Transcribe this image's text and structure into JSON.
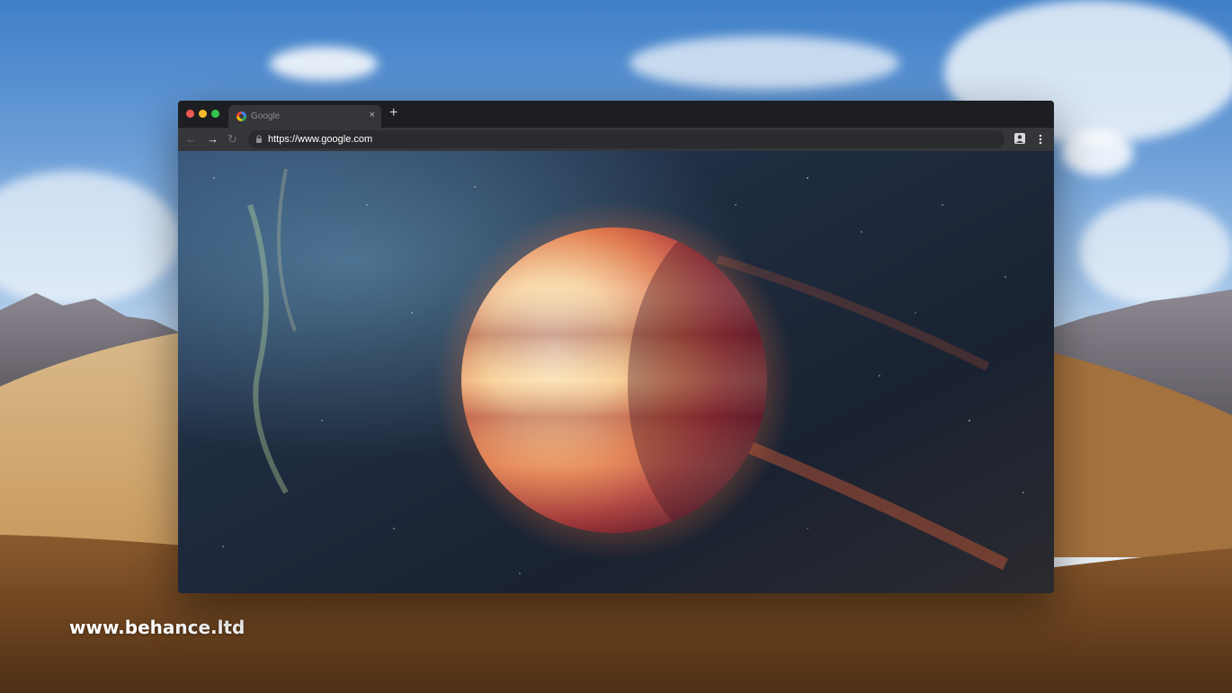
{
  "browser": {
    "tab": {
      "title": "Google",
      "favicon": "google-g-icon",
      "close_icon": "×"
    },
    "new_tab_icon": "+",
    "toolbar": {
      "back_icon": "←",
      "forward_icon": "→",
      "reload_icon": "↻",
      "url": "https://www.google.com"
    },
    "content": {
      "image": "space-planet-wallpaper"
    }
  },
  "desktop": {
    "wallpaper": "desert-dunes-wallpaper"
  },
  "watermark": {
    "text": "www.behance.ltd"
  },
  "colors": {
    "tabbar": "#1d1e21",
    "toolbar": "#35363a",
    "omnibox": "#2a2b2e",
    "close": "#ee5a52",
    "minimize": "#f3bb2d",
    "maximize": "#34c64a"
  }
}
